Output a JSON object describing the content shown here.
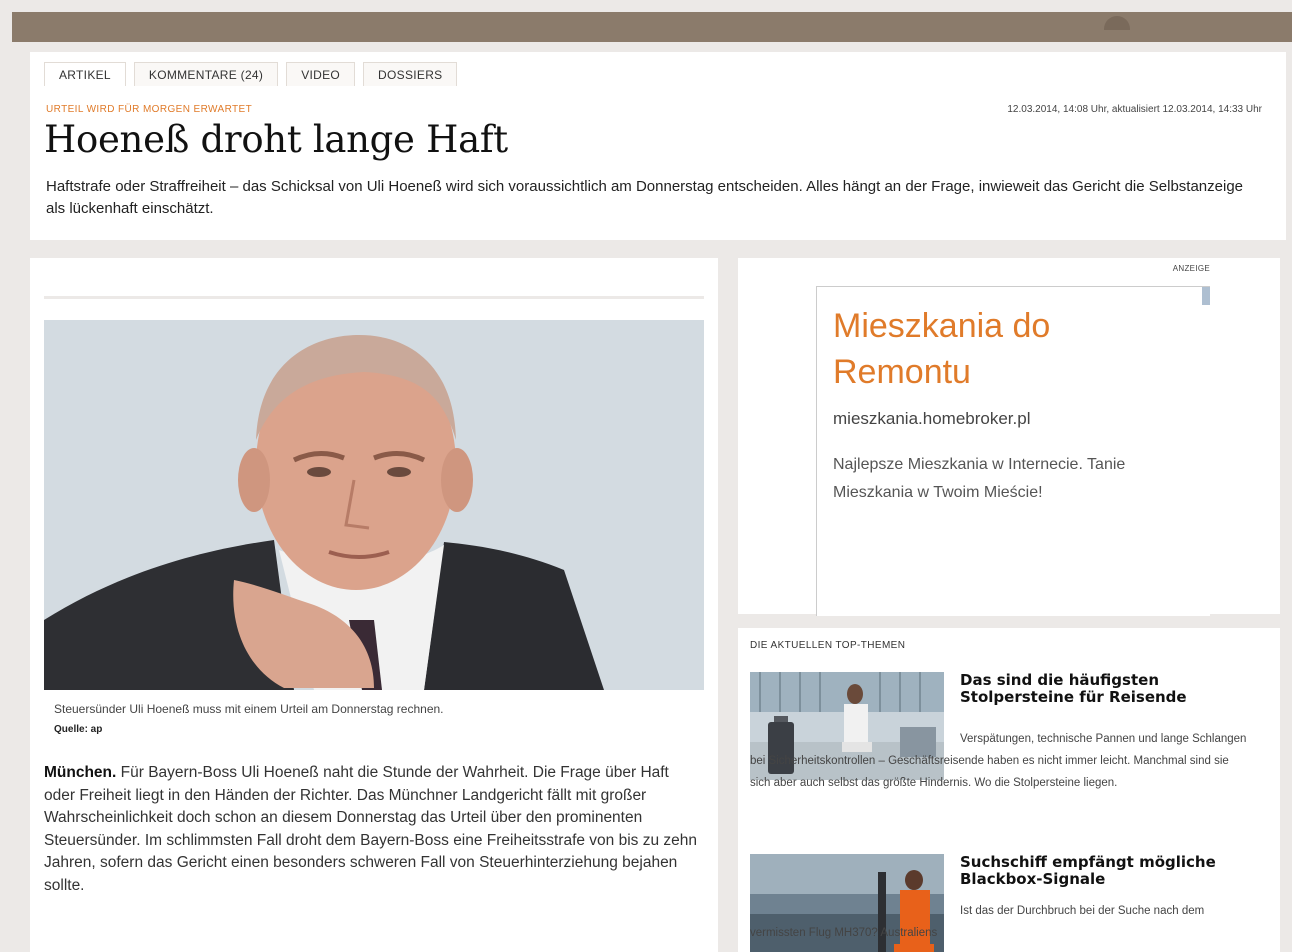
{
  "tabs": [
    {
      "label": "ARTIKEL"
    },
    {
      "label": "KOMMENTARE (24)"
    },
    {
      "label": "VIDEO"
    },
    {
      "label": "DOSSIERS"
    }
  ],
  "article": {
    "kicker": "URTEIL WIRD FÜR MORGEN ERWARTET",
    "dateline": "12.03.2014, 14:08 Uhr, aktualisiert 12.03.2014, 14:33 Uhr",
    "headline": "Hoeneß droht lange Haft",
    "lead": "Haftstrafe oder Straffreiheit – das Schicksal von Uli Hoeneß wird sich voraussichtlich am Donnerstag entscheiden. Alles hängt an der Frage, inwieweit das Gericht die Selbstanzeige als lückenhaft einschätzt.",
    "caption": "Steuersünder Uli Hoeneß muss mit einem Urteil am Donnerstag rechnen.",
    "source": "Quelle: ap",
    "body_location": "München.",
    "body": " Für Bayern-Boss Uli Hoeneß naht die Stunde der Wahrheit. Die Frage über Haft oder Freiheit liegt in den Händen der Richter. Das Münchner Landgericht fällt mit großer Wahrscheinlichkeit doch schon an diesem Donnerstag das Urteil über den prominenten Steuersünder. Im schlimmsten Fall droht dem Bayern-Boss eine Freiheitsstrafe von bis zu zehn Jahren, sofern das Gericht einen besonders schweren Fall von Steuerhinterziehung bejahen sollte."
  },
  "ad": {
    "label": "ANZEIGE",
    "title": "Mieszkania do Remontu",
    "url": "mieszkania.homebroker.pl",
    "description": "Najlepsze Mieszkania w Internecie. Tanie Mieszkania w Twoim Mieście!"
  },
  "top_topics": {
    "heading": "DIE AKTUELLEN TOP-THEMEN",
    "items": [
      {
        "title": "Das sind die häufigsten Stolpersteine für Reisende",
        "text": "Verspätungen, technische Pannen und lange Schlangen bei Sicherheitskontrollen – Geschäftsreisende haben es nicht immer leicht. Manchmal sind sie sich aber auch selbst das größte Hindernis. Wo die Stolpersteine liegen."
      },
      {
        "title": "Suchschiff empfängt mögliche Blackbox-Signale",
        "text": "Ist das der Durchbruch bei der Suche nach dem vermissten Flug MH370? Australiens"
      }
    ]
  },
  "colors": {
    "accent_orange": "#e07b2a",
    "topbar": "#8b7b6b",
    "background": "#ece9e7"
  }
}
